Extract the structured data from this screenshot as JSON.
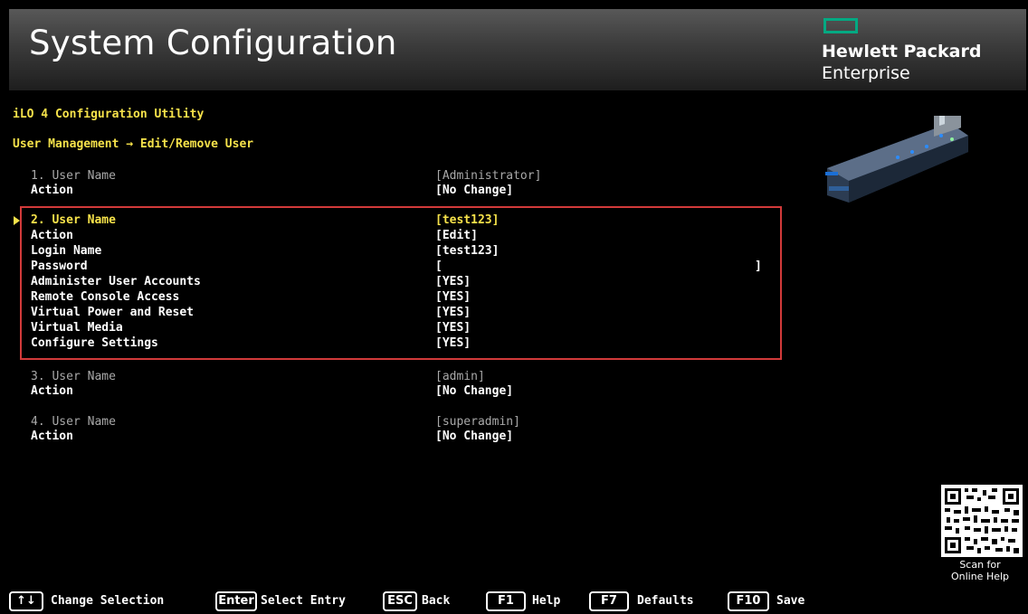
{
  "header": {
    "title": "System Configuration",
    "brand_line1": "Hewlett Packard",
    "brand_line2": "Enterprise",
    "brand_color": "#01a982"
  },
  "utility_title": "iLO 4 Configuration Utility",
  "breadcrumb": "User Management → Edit/Remove User",
  "users": [
    {
      "label": "1. User Name",
      "value": "[Administrator]",
      "action_label": "Action",
      "action_value": "[No Change]"
    },
    {
      "label": "2. User Name",
      "value": "[test123]",
      "fields": [
        {
          "label": "Action",
          "value": "[Edit]"
        },
        {
          "label": "Login Name",
          "value": "[test123]"
        },
        {
          "label": "Password",
          "value_open": "[",
          "value_close": "]"
        },
        {
          "label": "Administer User Accounts",
          "value": "[YES]"
        },
        {
          "label": "Remote Console Access",
          "value": "[YES]"
        },
        {
          "label": "Virtual Power and Reset",
          "value": "[YES]"
        },
        {
          "label": "Virtual Media",
          "value": "[YES]"
        },
        {
          "label": "Configure Settings",
          "value": "[YES]"
        }
      ]
    },
    {
      "label": "3. User Name",
      "value": "[admin]",
      "action_label": "Action",
      "action_value": "[No Change]"
    },
    {
      "label": "4. User Name",
      "value": "[superadmin]",
      "action_label": "Action",
      "action_value": "[No Change]"
    }
  ],
  "help": {
    "caption_line1": "Scan for",
    "caption_line2": "Online Help"
  },
  "footer": [
    {
      "key": "↑↓",
      "label": "Change Selection"
    },
    {
      "key": "Enter",
      "label": "Select Entry"
    },
    {
      "key": "ESC",
      "label": "Back"
    },
    {
      "key": "F1",
      "label": "Help"
    },
    {
      "key": "F7",
      "label": "Defaults"
    },
    {
      "key": "F10",
      "label": "Save"
    }
  ],
  "colors": {
    "highlight": "#f6e24a",
    "selection_border": "#d23a3a",
    "dim_text": "#a9a9a9"
  }
}
